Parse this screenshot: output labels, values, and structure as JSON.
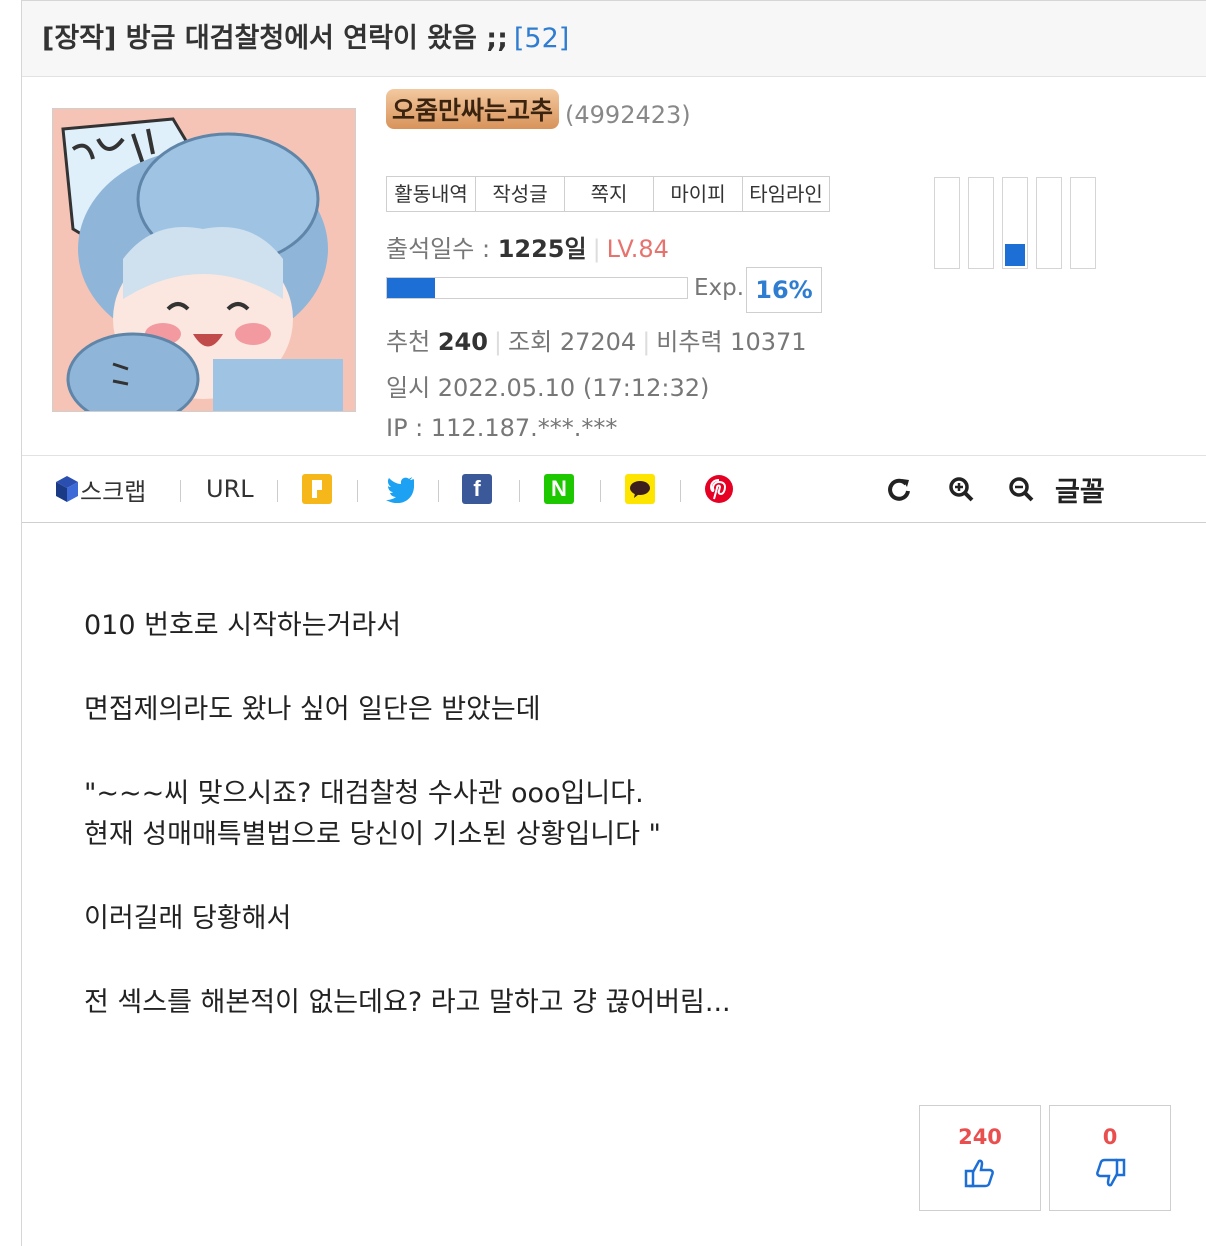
{
  "post": {
    "title": "[장작] 방금 대검찰청에서 연락이 왔음 ;;",
    "comment_count": "[52]"
  },
  "author": {
    "nickname": "오줌만싸는고추",
    "user_id": "(4992423)",
    "buttons": [
      "활동내역",
      "작성글",
      "쪽지",
      "마이피",
      "타임라인"
    ],
    "attendance_label": "출석일수 :",
    "attendance_value": "1225일",
    "level": "LV.84",
    "exp_label": "Exp.",
    "exp_percent": "16%",
    "exp_progress": 0.16,
    "meter_level": 3,
    "meter_cells": 5
  },
  "stats": {
    "recommend_label": "추천",
    "recommend_value": "240",
    "views_label": "조회",
    "views_value": "27204",
    "ratio_label": "비추력",
    "ratio_value": "10371",
    "date": "일시 2022.05.10 (17:12:32)",
    "ip": "IP : 112.187.***.***"
  },
  "share": {
    "scrap_label": "스크랩",
    "url_label": "URL",
    "font_label": "글꼴"
  },
  "body": {
    "lines": [
      "010 번호로 시작하는거라서",
      "면접제의라도 왔나 싶어 일단은 받았는데",
      "\"~~~씨 맞으시죠? 대검찰청 수사관 ooo입니다.",
      "현재 성매매특별법으로 당신이 기소된 상황입니다 \"",
      "이러길래 당황해서",
      "전 섹스를 해본적이 없는데요? 라고 말하고 걍 끊어버림..."
    ]
  },
  "votes": {
    "up": "240",
    "down": "0"
  },
  "colors": {
    "accent_blue": "#1d6fd6",
    "link_blue": "#2f7dd1",
    "red": "#e94f4f"
  }
}
